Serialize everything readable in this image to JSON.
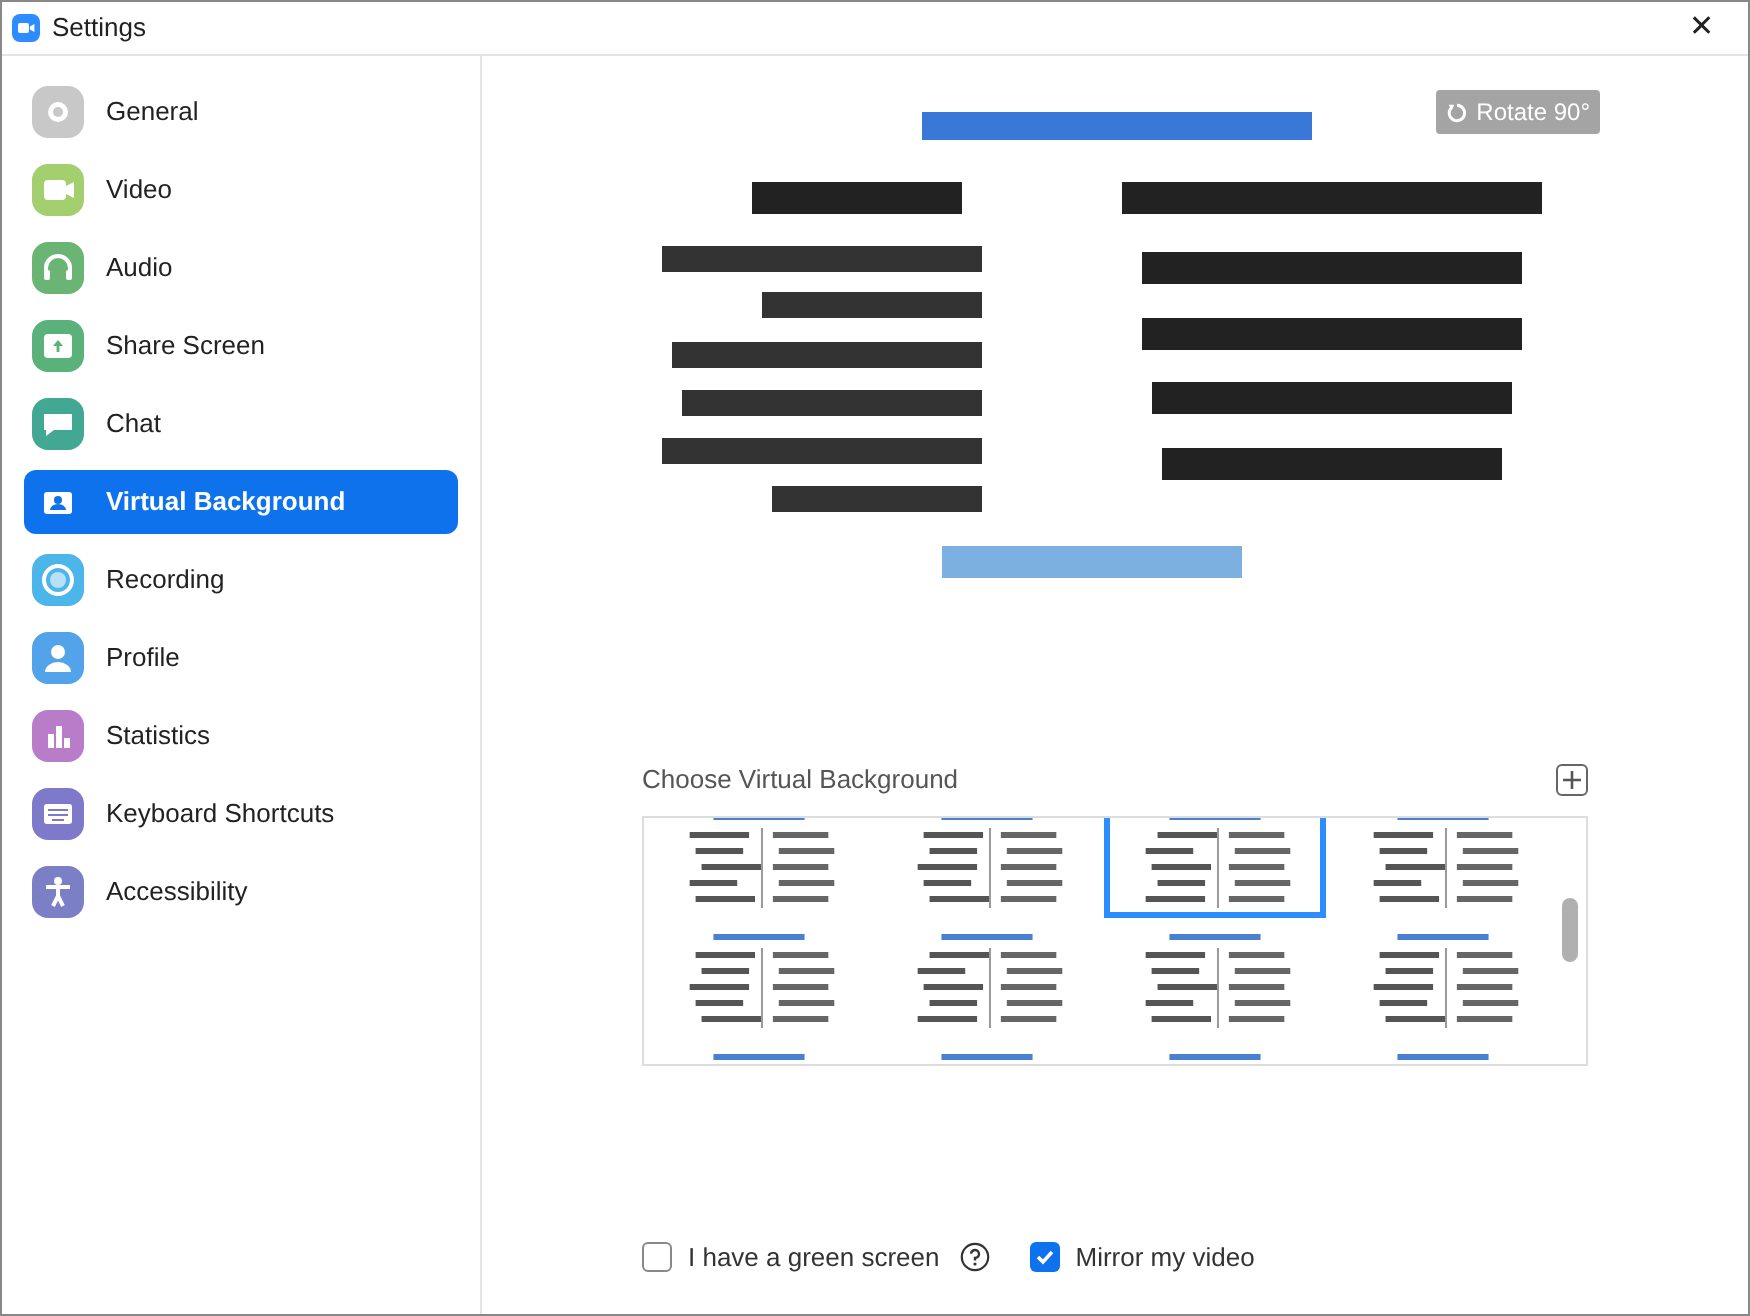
{
  "window": {
    "title": "Settings",
    "close": "✕"
  },
  "sidebar": {
    "items": [
      {
        "label": "General",
        "color": "#c8c8c8",
        "selected": false
      },
      {
        "label": "Video",
        "color": "#a3cf6e",
        "selected": false
      },
      {
        "label": "Audio",
        "color": "#6ab574",
        "selected": false
      },
      {
        "label": "Share Screen",
        "color": "#5ab27a",
        "selected": false
      },
      {
        "label": "Chat",
        "color": "#43a893",
        "selected": false
      },
      {
        "label": "Virtual Background",
        "color": "#0e72ed",
        "selected": true
      },
      {
        "label": "Recording",
        "color": "#4cb5ea",
        "selected": false
      },
      {
        "label": "Profile",
        "color": "#52a3ea",
        "selected": false
      },
      {
        "label": "Statistics",
        "color": "#b97cc9",
        "selected": false
      },
      {
        "label": "Keyboard Shortcuts",
        "color": "#7f79c9",
        "selected": false
      },
      {
        "label": "Accessibility",
        "color": "#7a7fc6",
        "selected": false
      }
    ]
  },
  "preview": {
    "kind": "picture",
    "rotate_button": "Rotate 90°"
  },
  "backgrounds": {
    "heading": "Choose Virtual Background",
    "thumbnails": [
      {
        "selected": false
      },
      {
        "selected": false
      },
      {
        "selected": true
      },
      {
        "selected": false
      },
      {
        "selected": false
      },
      {
        "selected": false
      },
      {
        "selected": false
      },
      {
        "selected": false
      },
      {
        "selected": false
      },
      {
        "selected": false
      },
      {
        "selected": false
      },
      {
        "selected": false
      }
    ]
  },
  "options": [
    {
      "label": "I have a green screen",
      "checked": false,
      "help": true
    },
    {
      "label": "Mirror my video",
      "checked": true,
      "help": false
    }
  ]
}
